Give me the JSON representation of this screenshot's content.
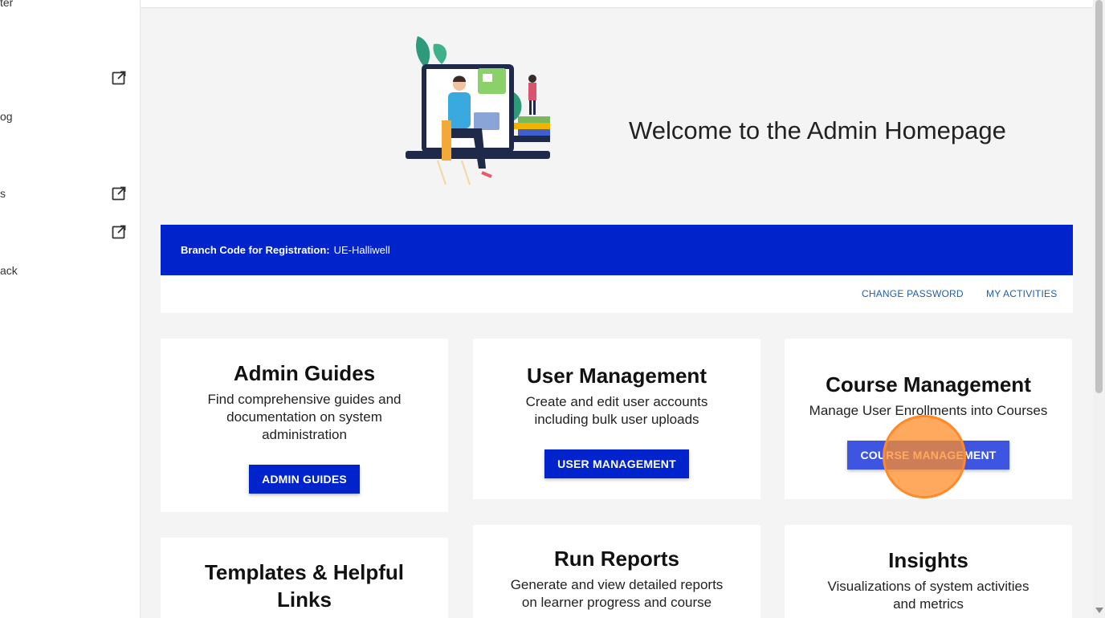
{
  "sidebar": {
    "items": [
      {
        "label": "ter",
        "external": false
      },
      {
        "label": "",
        "external": true
      },
      {
        "label": "og",
        "external": false
      },
      {
        "label": "s",
        "external": true
      },
      {
        "label": "",
        "external": true
      },
      {
        "label": "ack",
        "external": false
      }
    ]
  },
  "hero": {
    "title": "Welcome to the Admin Homepage"
  },
  "branch": {
    "label": "Branch Code for Registration:",
    "value": "UE-Halliwell"
  },
  "links": {
    "change_password": "CHANGE PASSWORD",
    "my_activities": "MY ACTIVITIES"
  },
  "cards": [
    {
      "title": "Admin Guides",
      "description": "Find comprehensive guides and documentation on system administration",
      "button": "ADMIN GUIDES"
    },
    {
      "title": "User Management",
      "description": "Create and edit user accounts including bulk user uploads",
      "button": "USER MANAGEMENT"
    },
    {
      "title": "Course Management",
      "description": "Manage User Enrollments into Courses",
      "button": "COURSE MANAGEMENT"
    },
    {
      "title": "Templates & Helpful Links",
      "description": "",
      "button": ""
    },
    {
      "title": "Run Reports",
      "description": "Generate and view detailed reports on learner progress and course",
      "button": ""
    },
    {
      "title": "Insights",
      "description": "Visualizations of system activities and metrics",
      "button": ""
    }
  ],
  "colors": {
    "brand_blue": "#0023cc",
    "link_blue": "#1f5fa8",
    "page_bg": "#f4f4f4",
    "click_marker": "#ff8a2a"
  }
}
